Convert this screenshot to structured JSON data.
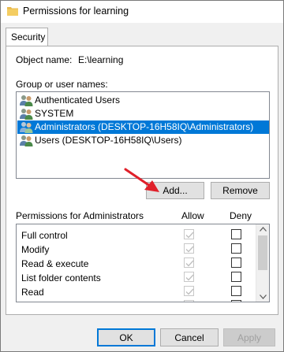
{
  "window": {
    "title": "Permissions for learning"
  },
  "tabs": [
    {
      "label": "Security"
    }
  ],
  "object": {
    "label": "Object name:",
    "value": "E:\\learning"
  },
  "groups": {
    "label": "Group or user names:",
    "items": [
      {
        "label": "Authenticated Users",
        "icon": "users-group-icon"
      },
      {
        "label": "SYSTEM",
        "icon": "users-group-icon"
      },
      {
        "label": "Administrators (DESKTOP-16H58IQ\\Administrators)",
        "icon": "users-group-icon",
        "selected": true
      },
      {
        "label": "Users (DESKTOP-16H58IQ\\Users)",
        "icon": "users-group-icon"
      }
    ],
    "add_label": "Add...",
    "remove_label": "Remove"
  },
  "permissions": {
    "header": "Permissions for Administrators",
    "allow_header": "Allow",
    "deny_header": "Deny",
    "rows": [
      {
        "name": "Full control",
        "allow": true,
        "deny": false
      },
      {
        "name": "Modify",
        "allow": true,
        "deny": false
      },
      {
        "name": "Read & execute",
        "allow": true,
        "deny": false
      },
      {
        "name": "List folder contents",
        "allow": true,
        "deny": false
      },
      {
        "name": "Read",
        "allow": true,
        "deny": false
      },
      {
        "name": "",
        "allow": true,
        "deny": false
      }
    ]
  },
  "footer": {
    "ok_label": "OK",
    "cancel_label": "Cancel",
    "apply_label": "Apply"
  },
  "colors": {
    "selection": "#0078d7",
    "annotation_arrow": "#e0202a"
  }
}
